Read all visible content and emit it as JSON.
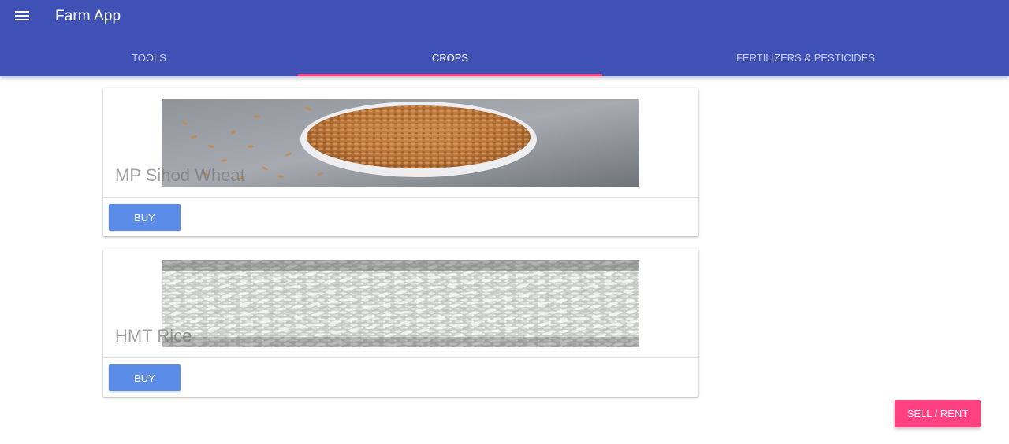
{
  "app": {
    "title": "Farm App"
  },
  "tabs": [
    {
      "label": "TOOLS",
      "active": false
    },
    {
      "label": "CROPS",
      "active": true
    },
    {
      "label": "FERTILIZERS & PESTICIDES",
      "active": false
    }
  ],
  "colors": {
    "appbar": "#3f51b5",
    "indicator": "#ff4081",
    "buy": "#5b8de8",
    "sell": "#ff4081"
  },
  "products": [
    {
      "title": "MP Sihod Wheat",
      "image": "wheat-grains-bowl-photo",
      "button": "BUY"
    },
    {
      "title": "HMT Rice",
      "image": "rice-grains-photo",
      "button": "BUY"
    }
  ],
  "fab": {
    "label": "SELL / RENT"
  }
}
